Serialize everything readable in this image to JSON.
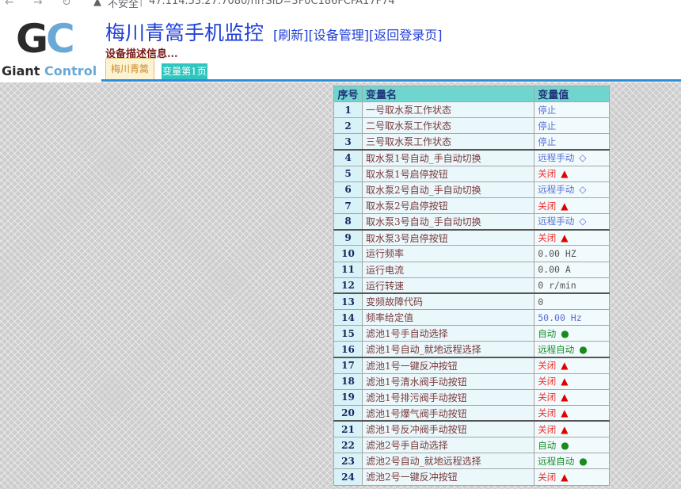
{
  "browser": {
    "warning": "不安全",
    "url": "47.114.53.27:7080/ni?SID=3F0C186FCFA17F74"
  },
  "header": {
    "logo_mark": "GC",
    "brand_word1": "Giant",
    "brand_word2": "Control",
    "title": "梅川青篙手机监控",
    "link_refresh": "[刷新]",
    "link_devices": "[设备管理]",
    "link_login": "[返回登录页]",
    "description": "设备描述信息..."
  },
  "tabs": [
    "梅川青篙",
    "变量第1页"
  ],
  "table": {
    "headers": [
      "序号",
      "变量名",
      "变量值"
    ],
    "rows": [
      {
        "no": "1",
        "name": "一号取水泵工作状态",
        "value": "停止",
        "color": "blue",
        "icon": "",
        "group_start": false
      },
      {
        "no": "2",
        "name": "二号取水泵工作状态",
        "value": "停止",
        "color": "blue",
        "icon": "",
        "group_start": false
      },
      {
        "no": "3",
        "name": "三号取水泵工作状态",
        "value": "停止",
        "color": "blue",
        "icon": "",
        "group_start": false
      },
      {
        "no": "4",
        "name": "取水泵1号自动_手自动切换",
        "value": "远程手动",
        "color": "blue",
        "icon": "diamond",
        "group_start": true
      },
      {
        "no": "5",
        "name": "取水泵1号启停按钮",
        "value": "关闭",
        "color": "red",
        "icon": "triangle",
        "group_start": false
      },
      {
        "no": "6",
        "name": "取水泵2号自动_手自动切换",
        "value": "远程手动",
        "color": "blue",
        "icon": "diamond",
        "group_start": false
      },
      {
        "no": "7",
        "name": "取水泵2号启停按钮",
        "value": "关闭",
        "color": "red",
        "icon": "triangle",
        "group_start": false
      },
      {
        "no": "8",
        "name": "取水泵3号自动_手自动切换",
        "value": "远程手动",
        "color": "blue",
        "icon": "diamond",
        "group_start": false
      },
      {
        "no": "9",
        "name": "取水泵3号启停按钮",
        "value": "关闭",
        "color": "red",
        "icon": "triangle",
        "group_start": true
      },
      {
        "no": "10",
        "name": "运行频率",
        "value": "0.00 HZ",
        "color": "gray",
        "icon": "",
        "group_start": false
      },
      {
        "no": "11",
        "name": "运行电流",
        "value": "0.00 A",
        "color": "gray",
        "icon": "",
        "group_start": false
      },
      {
        "no": "12",
        "name": "运行转速",
        "value": "0 r/min",
        "color": "gray",
        "icon": "",
        "group_start": false
      },
      {
        "no": "13",
        "name": "变频故障代码",
        "value": "0",
        "color": "gray",
        "icon": "",
        "group_start": true
      },
      {
        "no": "14",
        "name": "频率给定值",
        "value": "50.00 Hz",
        "color": "blue",
        "icon": "",
        "group_start": false
      },
      {
        "no": "15",
        "name": "滤池1号手自动选择",
        "value": "自动",
        "color": "green",
        "icon": "dot",
        "group_start": false
      },
      {
        "no": "16",
        "name": "滤池1号自动_就地远程选择",
        "value": "远程自动",
        "color": "green",
        "icon": "dot",
        "group_start": false
      },
      {
        "no": "17",
        "name": "滤池1号一键反冲按钮",
        "value": "关闭",
        "color": "red",
        "icon": "triangle",
        "group_start": true
      },
      {
        "no": "18",
        "name": "滤池1号清水阀手动按钮",
        "value": "关闭",
        "color": "red",
        "icon": "triangle",
        "group_start": false
      },
      {
        "no": "19",
        "name": "滤池1号排污阀手动按钮",
        "value": "关闭",
        "color": "red",
        "icon": "triangle",
        "group_start": false
      },
      {
        "no": "20",
        "name": "滤池1号爆气阀手动按钮",
        "value": "关闭",
        "color": "red",
        "icon": "triangle",
        "group_start": false
      },
      {
        "no": "21",
        "name": "滤池1号反冲阀手动按钮",
        "value": "关闭",
        "color": "red",
        "icon": "triangle",
        "group_start": true
      },
      {
        "no": "22",
        "name": "滤池2号手自动选择",
        "value": "自动",
        "color": "green",
        "icon": "dot",
        "group_start": false
      },
      {
        "no": "23",
        "name": "滤池2号自动_就地远程选择",
        "value": "远程自动",
        "color": "green",
        "icon": "dot",
        "group_start": false
      },
      {
        "no": "24",
        "name": "滤池2号一键反冲按钮",
        "value": "关闭",
        "color": "red",
        "icon": "triangle",
        "group_start": false
      }
    ]
  }
}
